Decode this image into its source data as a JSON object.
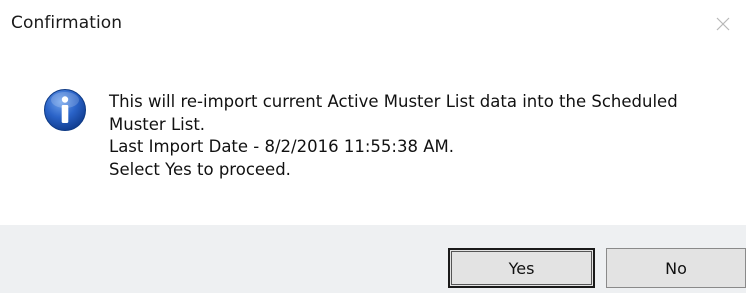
{
  "window": {
    "title": "Confirmation",
    "close_icon": "close-icon"
  },
  "content": {
    "icon": "information-icon",
    "message_lines": [
      "This will re-import current Active Muster List data into the Scheduled",
      "Muster List.",
      "Last Import Date - 8/2/2016 11:55:38 AM.",
      "Select Yes to proceed."
    ]
  },
  "buttons": {
    "yes_label": "Yes",
    "no_label": "No"
  },
  "colors": {
    "footer_background": "#eef0f2",
    "icon_blue": "#2a63c8",
    "default_button_border": "#1a1a1a"
  }
}
